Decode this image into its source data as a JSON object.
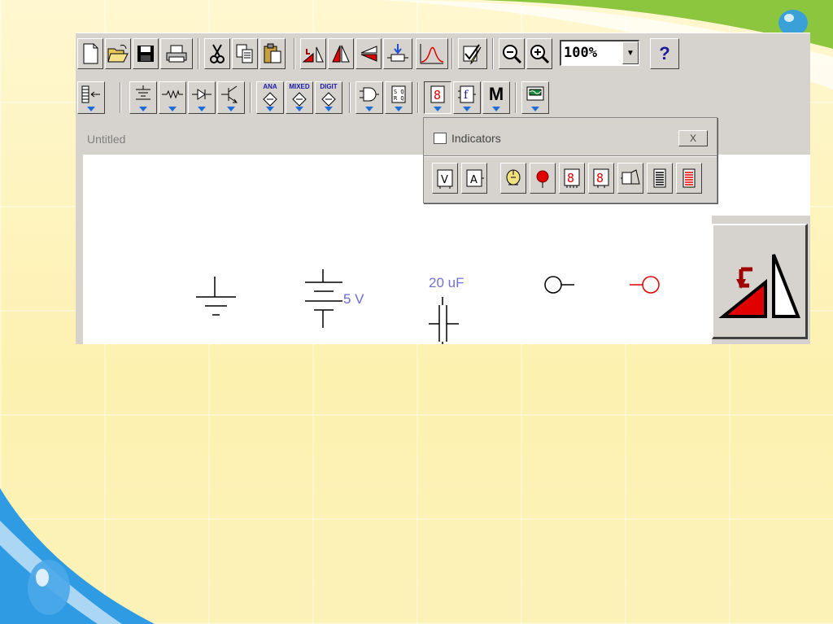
{
  "toolbar": {
    "zoom_value": "100%",
    "help_label": "?",
    "row2_labels": {
      "analog": "ANA",
      "mixed": "MIXED",
      "digital": "DIGIT",
      "misc": "M"
    }
  },
  "window": {
    "title": "Untitled"
  },
  "indicators_palette": {
    "title": "Indicators",
    "close_label": "X",
    "buttons": [
      "voltmeter",
      "ammeter",
      "lamp",
      "probe",
      "seven-segment-display",
      "decoded-seven-segment-display",
      "buzzer",
      "bargraph",
      "bargraph-display"
    ]
  },
  "canvas": {
    "battery_label": "5 V",
    "capacitor_label": "20 uF"
  },
  "colors": {
    "accent_green": "#7fc41a",
    "accent_blue": "#1e6cd8",
    "red": "#e00000"
  }
}
